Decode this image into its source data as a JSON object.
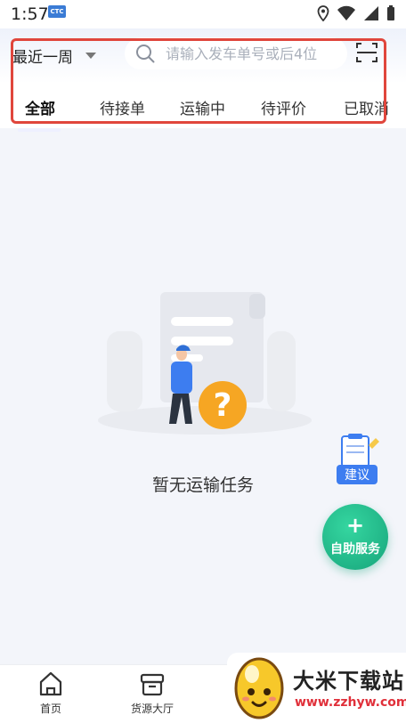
{
  "status_bar": {
    "time": "1:57",
    "notification_badge": "CTC"
  },
  "filter": {
    "range_label": "最近一周"
  },
  "search": {
    "placeholder": "请输入发车单号或后4位"
  },
  "tabs": [
    {
      "label": "全部",
      "active": true
    },
    {
      "label": "待接单",
      "active": false
    },
    {
      "label": "运输中",
      "active": false
    },
    {
      "label": "待评价",
      "active": false
    },
    {
      "label": "已取消",
      "active": false
    }
  ],
  "empty_state": {
    "message": "暂无运输任务"
  },
  "floating": {
    "suggest_label": "建议",
    "self_service_plus": "+",
    "self_service_label": "自助服务"
  },
  "bottom_nav": [
    {
      "label": "首页",
      "icon": "home-icon"
    },
    {
      "label": "货源大厅",
      "icon": "box-icon"
    }
  ],
  "watermark": {
    "title": "大米下载站",
    "url": "www.zzhyw.com"
  },
  "colors": {
    "accent": "#3d7df0",
    "self_service": "#17a57b",
    "highlight": "#e0463c"
  }
}
